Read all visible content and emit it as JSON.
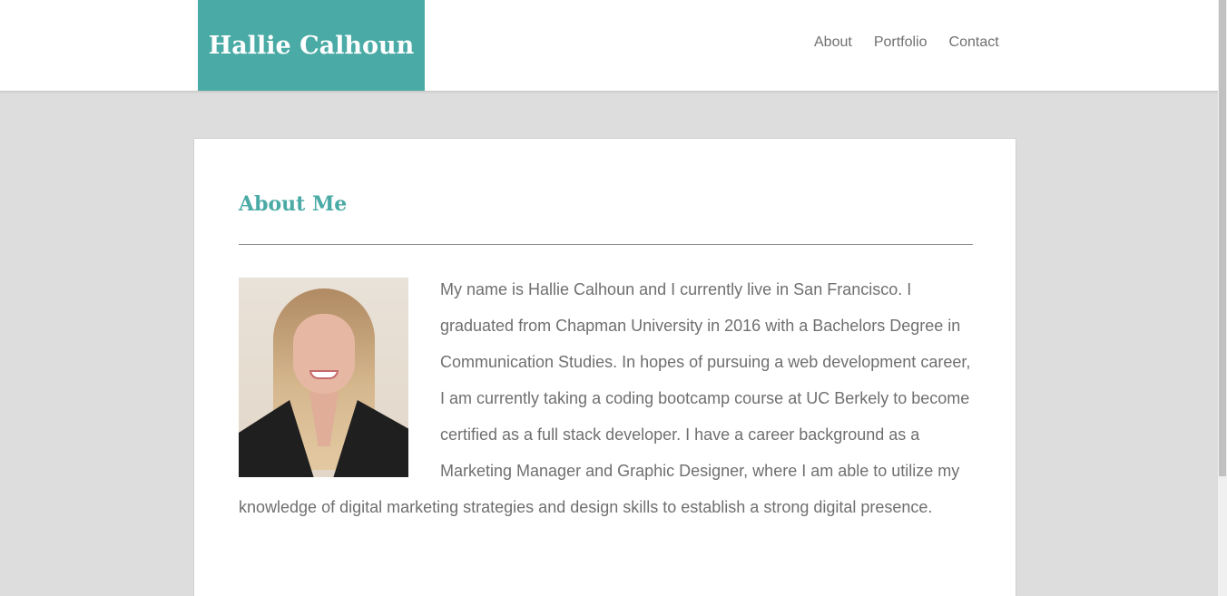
{
  "header": {
    "brand": "Hallie Calhoun",
    "nav": [
      "About",
      "Portfolio",
      "Contact"
    ]
  },
  "about": {
    "title": "About Me",
    "photo_alt": "Hallie Calhoun portrait photo",
    "bio": "My name is Hallie Calhoun and I currently live in San Francisco. I graduated from Chapman University in 2016 with a Bachelors Degree in Communication Studies. In hopes of pursuing a web development career, I am currently taking a coding bootcamp course at UC Berkely to become certified as a full stack developer. I have a career background as a Marketing Manager and Graphic Designer, where I am able to utilize my knowledge of digital marketing strategies and design skills to establish a strong digital presence."
  },
  "colors": {
    "accent": "#4aaaa5",
    "background": "#dddddd",
    "text": "#6f6f6f"
  },
  "icons": {
    "photo": "portrait-photo"
  }
}
